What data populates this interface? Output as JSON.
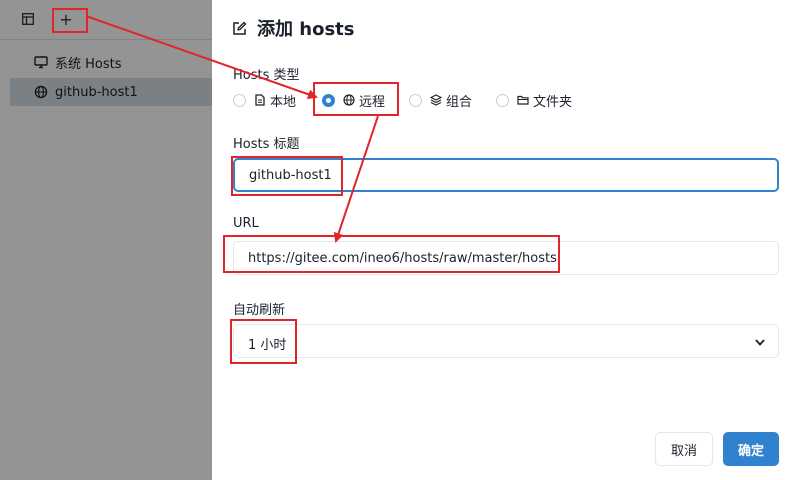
{
  "sidebar": {
    "items": [
      {
        "label": "系统 Hosts",
        "icon": "monitor-icon"
      },
      {
        "label": "github-host1",
        "icon": "globe-icon"
      }
    ]
  },
  "toolbar": {
    "add_label": "+"
  },
  "dialog": {
    "title": "添加 hosts",
    "type_label": "Hosts 类型",
    "types": [
      {
        "label": "本地",
        "icon": "file-icon",
        "selected": false
      },
      {
        "label": "远程",
        "icon": "globe-icon",
        "selected": true
      },
      {
        "label": "组合",
        "icon": "layers-icon",
        "selected": false
      },
      {
        "label": "文件夹",
        "icon": "folder-icon",
        "selected": false
      }
    ],
    "title_label": "Hosts 标题",
    "title_value": "github-host1",
    "url_label": "URL",
    "url_value": "https://gitee.com/ineo6/hosts/raw/master/hosts",
    "refresh_label": "自动刷新",
    "refresh_value": "1 小时",
    "cancel_label": "取消",
    "confirm_label": "确定"
  },
  "colors": {
    "accent": "#3182ce",
    "annotation": "#e0252b"
  }
}
